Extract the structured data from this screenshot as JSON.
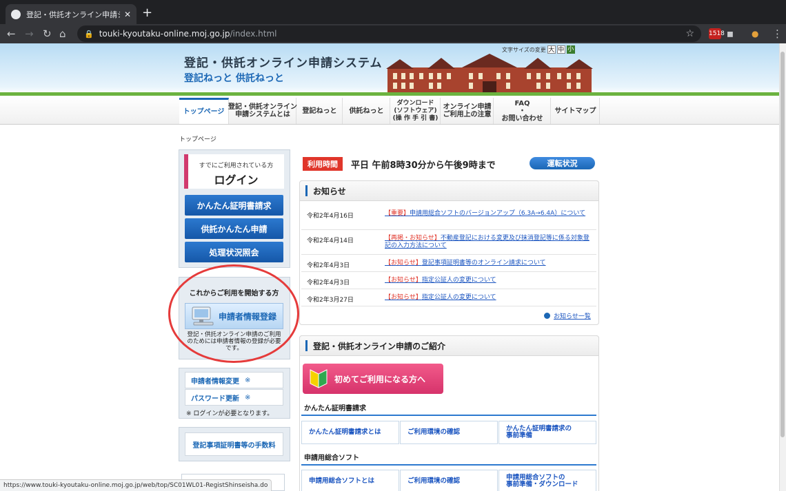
{
  "browser": {
    "tab_title": "登記・供託オンライン申請システム",
    "url_host": "touki-kyoutaku-online.moj.go.jp",
    "url_path": "/index.html",
    "badge_count": "1518",
    "status_url": "https://www.touki-kyoutaku-online.moj.go.jp/web/top/SC01WL01-RegistShinseisha.do"
  },
  "header": {
    "title": "登記・供託オンライン申請システム",
    "subtitle": "登記ねっと 供託ねっと",
    "fontsize_label": "文字サイズの変更",
    "fontsize_large": "大",
    "fontsize_medium": "中",
    "fontsize_small": "小"
  },
  "nav": [
    {
      "label": "トップページ"
    },
    {
      "label": "登記・供託オンライン\n申請システムとは"
    },
    {
      "label": "登記ねっと"
    },
    {
      "label": "供託ねっと"
    },
    {
      "label": "ダウンロード\n(ソフトウェア)\n(操 作 手 引 書)"
    },
    {
      "label": "オンライン申請\nご利用上の注意"
    },
    {
      "label": "FAQ\n・\nお問い合わせ"
    },
    {
      "label": "サイトマップ"
    }
  ],
  "breadcrumb": "トップページ",
  "sidebar": {
    "login_small": "すでにご利用されている方",
    "login_big": "ログイン",
    "buttons": [
      "かんたん証明書請求",
      "供託かんたん申請",
      "処理状況照会"
    ],
    "start_title": "これからご利用を開始する方",
    "register_label": "申請者情報登録",
    "register_note": "登記・供託オンライン申請のご利用のためには申請者情報の登録が必要です。",
    "links": [
      {
        "label": "申請者情報変更",
        "mark": "※"
      },
      {
        "label": "パスワード更新",
        "mark": "※"
      }
    ],
    "login_required_note": "※ ログインが必要となります。",
    "fee_label": "登記事項証明書等の手数料"
  },
  "hours": {
    "badge": "利用時間",
    "text": "平日 午前8時30分から午後9時まで",
    "status_button": "運転状況"
  },
  "news": {
    "title": "お知らせ",
    "items": [
      {
        "date": "令和2年4月16日",
        "tag": "【重要】",
        "text": "申請用総合ソフトのバージョンアップ（6.3A→6.4A）について"
      },
      {
        "date": "令和2年4月14日",
        "tag": "【再掲・お知らせ】",
        "text": "不動産登記における変更及び抹消登記等に係る対象登記の入力方法について"
      },
      {
        "date": "令和2年4月3日",
        "tag": "【お知らせ】",
        "text": "登記事項証明書等のオンライン請求について"
      },
      {
        "date": "令和2年4月3日",
        "tag": "【お知らせ】",
        "text": "指定公証人の変更について"
      },
      {
        "date": "令和2年3月27日",
        "tag": "【お知らせ】",
        "text": "指定公証人の変更について"
      }
    ],
    "all_link": "お知らせ一覧"
  },
  "intro": {
    "title": "登記・供託オンライン申請のご紹介",
    "first_button": "初めてご利用になる方へ",
    "section1": "かんたん証明書請求",
    "cells1": [
      "かんたん証明書請求とは",
      "ご利用環境の確認",
      "かんたん証明書請求の\n事前準備"
    ],
    "section2": "申請用総合ソフト",
    "cells2": [
      "申請用総合ソフトとは",
      "ご利用環境の確認",
      "申請用総合ソフトの\n事前準備・ダウンロード"
    ]
  },
  "colors": {
    "accent": "#1b67b5",
    "alert": "#e0362b",
    "annotation": "#e53b3b"
  }
}
